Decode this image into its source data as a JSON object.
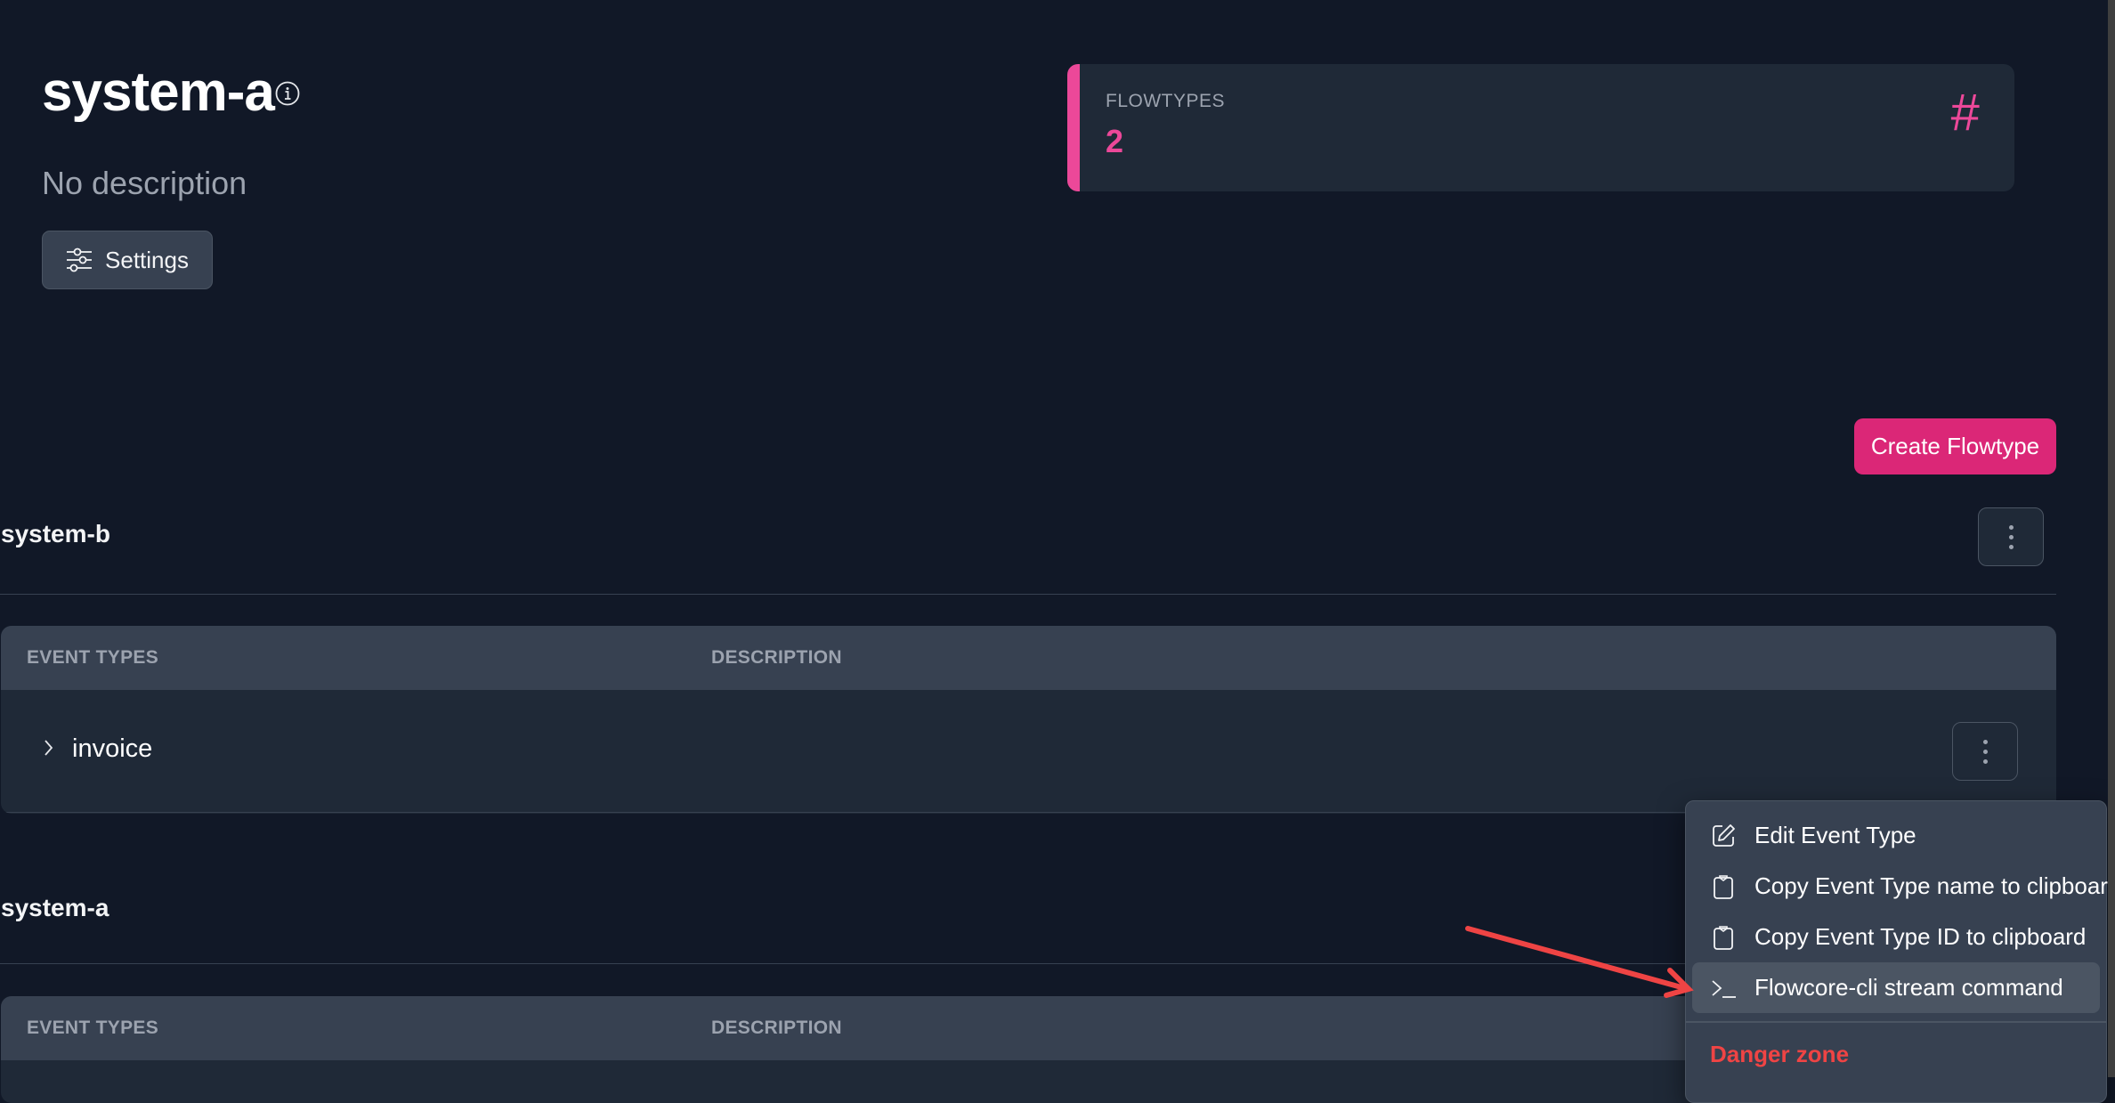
{
  "header": {
    "title": "system-a",
    "info_icon": "info-circle-icon",
    "description": "No description",
    "settings_label": "Settings",
    "settings_icon": "sliders-icon"
  },
  "stat_card": {
    "label": "FLOWTYPES",
    "value": "2",
    "icon": "hash-icon",
    "icon_glyph": "#",
    "accent_color": "#ec4899"
  },
  "actions": {
    "create_flowtype_label": "Create Flowtype",
    "accent_color": "#db2777"
  },
  "flowtypes": [
    {
      "name": "system-b",
      "columns": [
        "EVENT TYPES",
        "DESCRIPTION"
      ],
      "rows": [
        {
          "name": "invoice",
          "description": ""
        }
      ]
    },
    {
      "name": "system-a",
      "columns": [
        "EVENT TYPES",
        "DESCRIPTION"
      ],
      "rows": []
    }
  ],
  "context_menu": {
    "items": [
      {
        "label": "Edit Event Type",
        "icon": "edit-icon"
      },
      {
        "label": "Copy Event Type name to clipboard",
        "icon": "clipboard-icon"
      },
      {
        "label": "Copy Event Type ID to clipboard",
        "icon": "clipboard-icon"
      },
      {
        "label": "Flowcore-cli stream command",
        "icon": "terminal-icon",
        "highlighted": true
      }
    ],
    "danger_label": "Danger zone",
    "danger_color": "#ef4444"
  },
  "annotation": {
    "type": "arrow",
    "color": "#ef4444",
    "points_to": "Flowcore-cli stream command"
  }
}
